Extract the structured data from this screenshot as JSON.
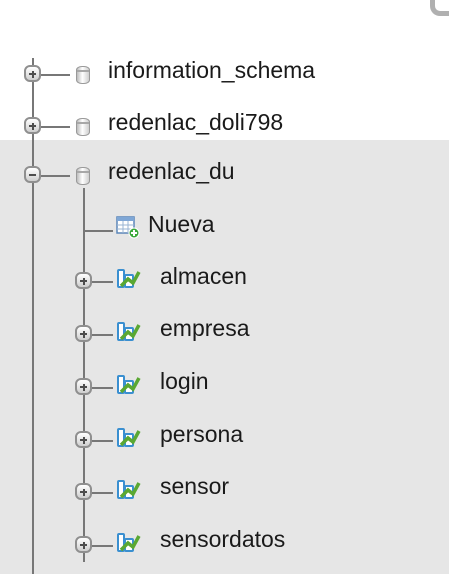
{
  "databases": [
    {
      "label": "information_schema",
      "expanded": false
    },
    {
      "label": "redenlac_doli798",
      "expanded": false
    },
    {
      "label": "redenlac_du",
      "expanded": true
    }
  ],
  "new_item": {
    "label": "Nueva",
    "icon": "new-table-icon"
  },
  "tables": [
    {
      "label": "almacen"
    },
    {
      "label": "empresa"
    },
    {
      "label": "login"
    },
    {
      "label": "persona"
    },
    {
      "label": "sensor"
    },
    {
      "label": "sensordatos"
    }
  ],
  "colors": {
    "highlight": "#e6e6e6",
    "tree_line": "#777777",
    "table_icon_blue": "#3a8fd0",
    "table_icon_green": "#5aa832"
  }
}
